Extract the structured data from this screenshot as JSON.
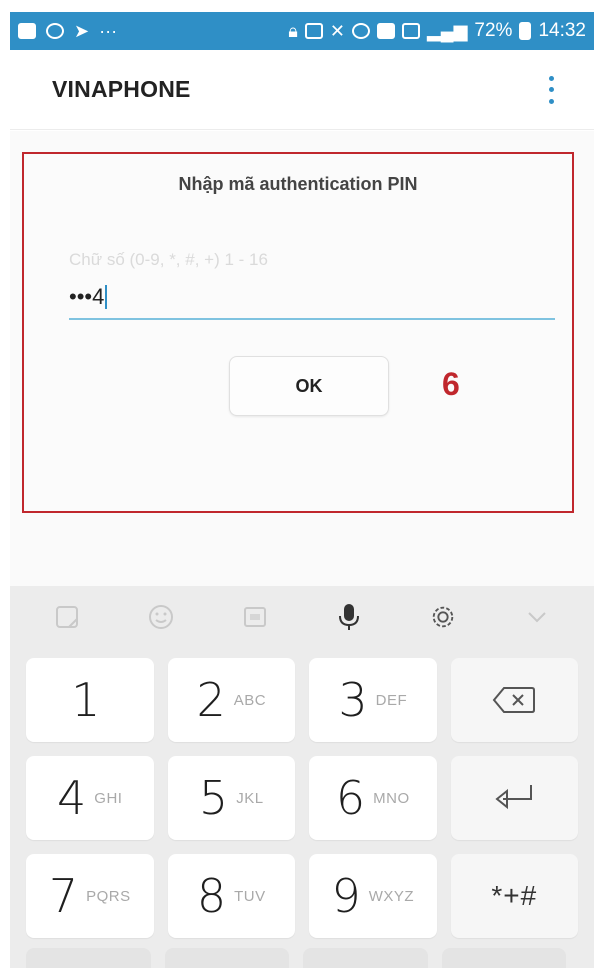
{
  "statusbar": {
    "battery": "72%",
    "time": "14:32",
    "left_icons": [
      "video-icon",
      "location-icon",
      "send-icon",
      "more-icon"
    ],
    "right_icons": [
      "lock-icon",
      "cast-icon",
      "mute-icon",
      "sync-icon",
      "nfc-icon",
      "data-icon",
      "signal-icon",
      "battery-icon"
    ]
  },
  "appbar": {
    "title": "VINAPHONE"
  },
  "dialog": {
    "title": "Nhập mã authentication PIN",
    "pin_hint": "Chữ số (0-9, *, #, +) 1 - 16",
    "pin_value": "•••4",
    "ok_label": "OK"
  },
  "annotation": {
    "step_number": "6",
    "color": "#c0272d"
  },
  "keyboard": {
    "toolbar": [
      "sticker-icon",
      "emoji-icon",
      "gif-icon",
      "microphone-icon",
      "settings-icon",
      "chevron-down-icon"
    ],
    "rows": [
      [
        {
          "digit": "1",
          "letters": ""
        },
        {
          "digit": "2",
          "letters": "ABC"
        },
        {
          "digit": "3",
          "letters": "DEF"
        },
        {
          "func": "backspace-icon"
        }
      ],
      [
        {
          "digit": "4",
          "letters": "GHI"
        },
        {
          "digit": "5",
          "letters": "JKL"
        },
        {
          "digit": "6",
          "letters": "MNO"
        },
        {
          "func": "enter-icon"
        }
      ],
      [
        {
          "digit": "7",
          "letters": "PQRS"
        },
        {
          "digit": "8",
          "letters": "TUV"
        },
        {
          "digit": "9",
          "letters": "WXYZ"
        },
        {
          "symbols": "*+#"
        }
      ]
    ]
  },
  "colors": {
    "statusbar": "#2f8fc6",
    "accent": "#2f8fc6",
    "frame": "#c0272d",
    "keyboard_bg": "#ececec"
  }
}
